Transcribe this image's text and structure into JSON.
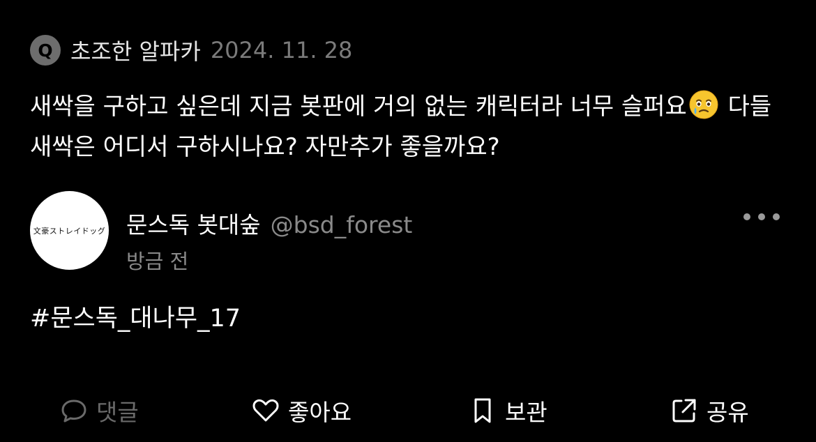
{
  "question": {
    "badge": "Q",
    "asker_name": "초조한 알파카",
    "date": "2024. 11. 28",
    "text_before_emoji": "새싹을 구하고 싶은데 지금 봇판에 거의 없는 캐릭터라 너무 슬퍼요",
    "emoji_icon": "face-holding-back-tears-icon",
    "text_after_emoji": " 다들 새싹은 어디서 구하시나요? 자만추가 좋을까요?"
  },
  "answer": {
    "avatar_text": "文豪ストレイドッグ",
    "account_name": "문스독 봇대숲",
    "handle": "@bsd_forest",
    "time_ago": "방금 전",
    "more_icon": "more-horizontal-icon",
    "hashtag": "#문스독_대나무_17"
  },
  "actions": {
    "comment": {
      "label": "댓글",
      "icon": "comment-bubble-icon",
      "color": "#6a6a6a"
    },
    "like": {
      "label": "좋아요",
      "icon": "heart-icon",
      "color": "#ffffff"
    },
    "save": {
      "label": "보관",
      "icon": "bookmark-icon",
      "color": "#ffffff"
    },
    "share": {
      "label": "공유",
      "icon": "share-icon",
      "color": "#ffffff"
    }
  },
  "colors": {
    "background": "#000000",
    "text_primary": "#ffffff",
    "text_secondary": "#8a8a8a",
    "disabled": "#6a6a6a",
    "badge_bg": "#6d6d6d"
  }
}
